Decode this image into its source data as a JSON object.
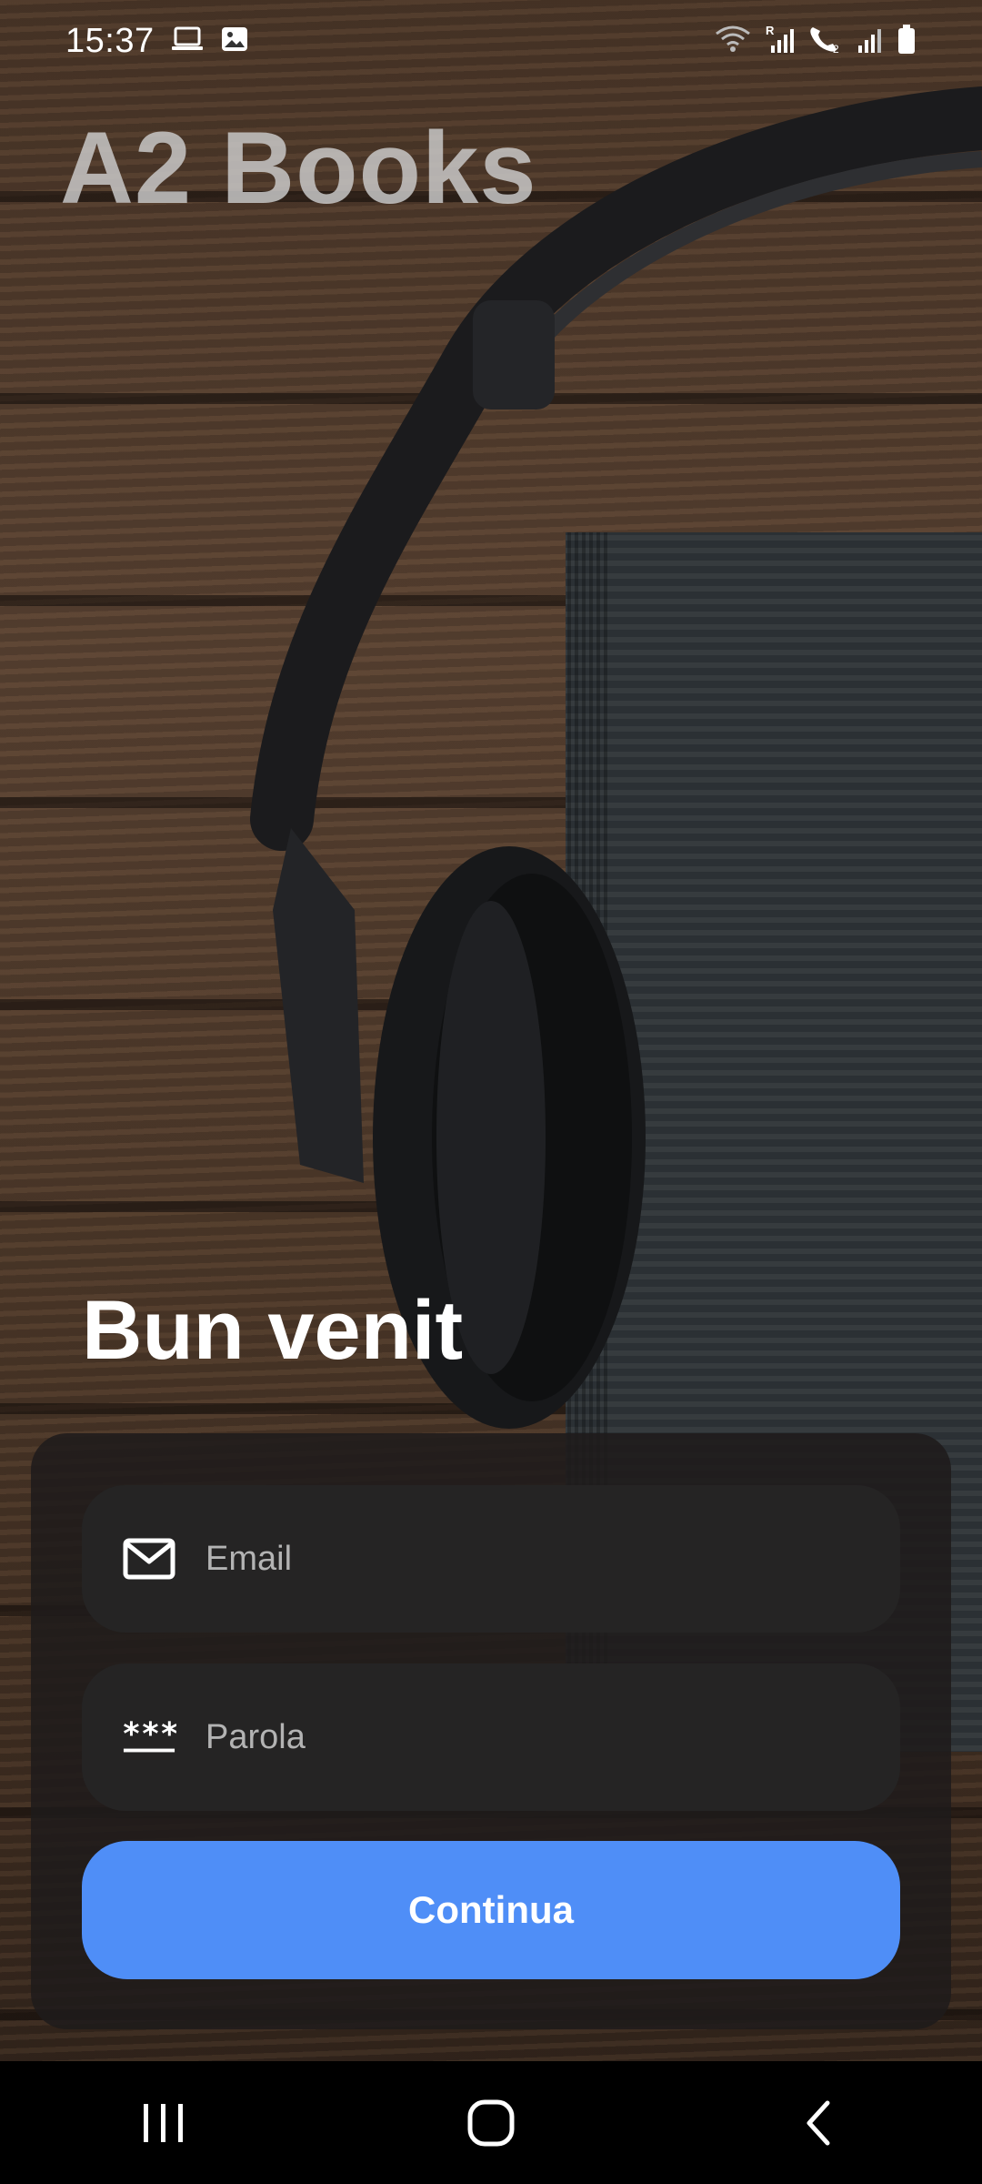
{
  "status_bar": {
    "time": "15:37",
    "left_icons": [
      "laptop-icon",
      "image-icon"
    ],
    "right_icons": [
      "wifi-icon",
      "signal-r-icon",
      "volte-call-icon",
      "signal-icon",
      "battery-icon"
    ]
  },
  "app": {
    "title": "A2 Books"
  },
  "login": {
    "heading": "Bun venit",
    "email": {
      "placeholder": "Email",
      "value": "",
      "icon": "mail-icon"
    },
    "password": {
      "placeholder": "Parola",
      "value": "",
      "icon": "password-icon"
    },
    "continue_label": "Continua",
    "accent_color": "#4f8ef7"
  },
  "nav_bar": {
    "buttons": [
      "recents-icon",
      "home-icon",
      "back-icon"
    ]
  }
}
